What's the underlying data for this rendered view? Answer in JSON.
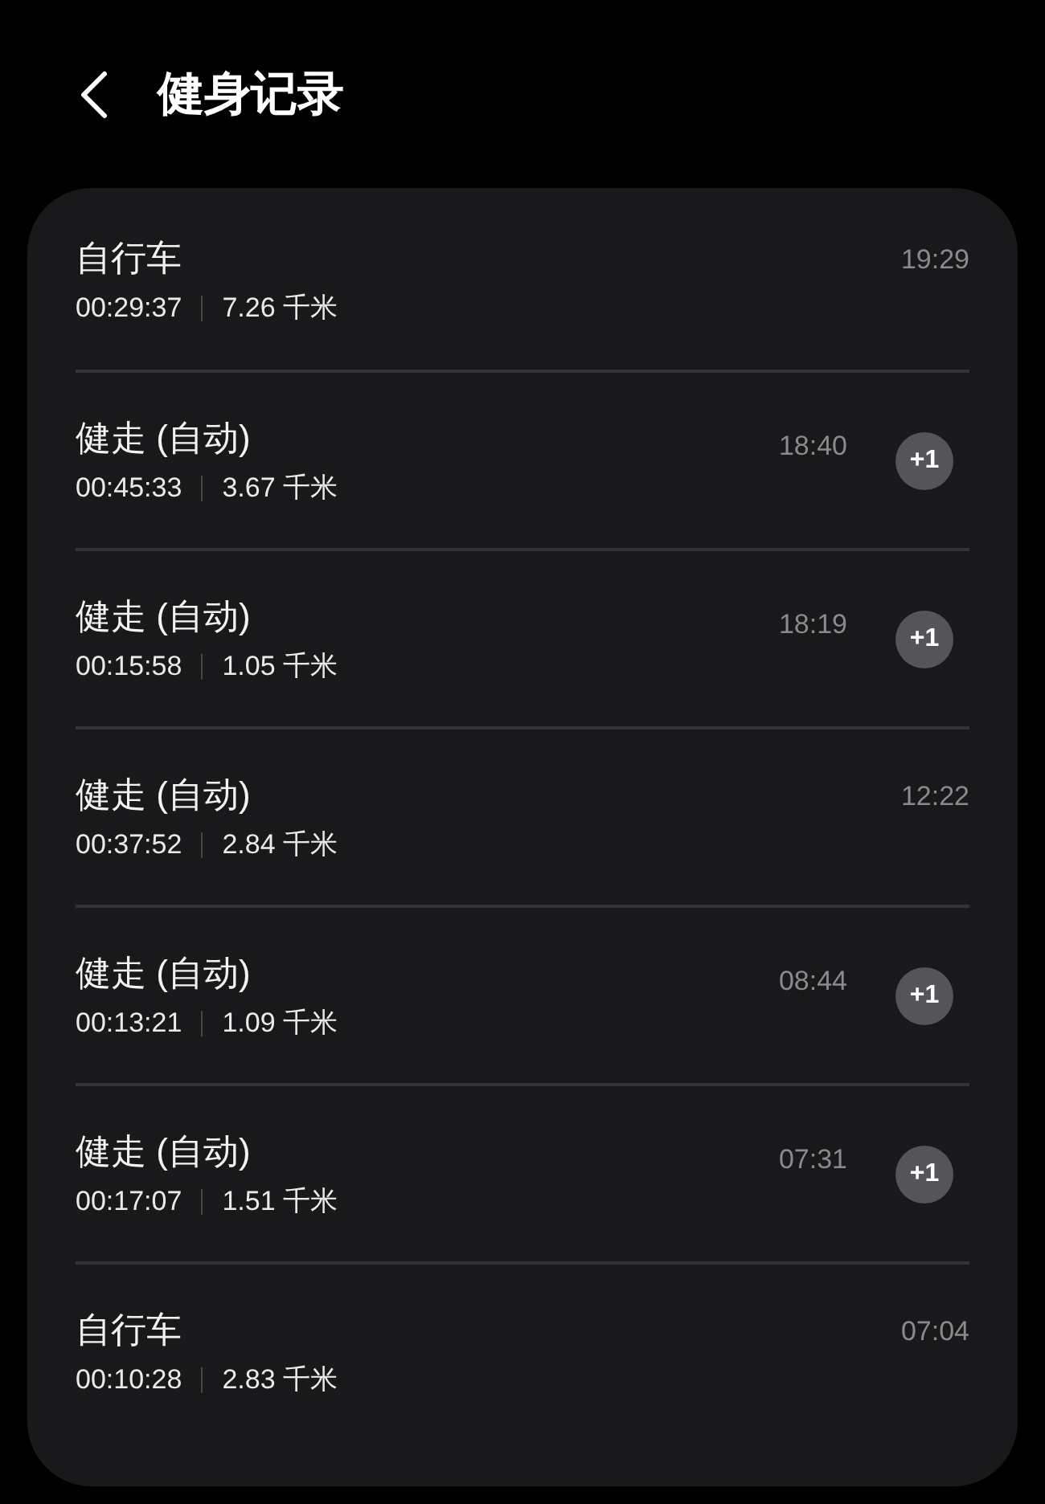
{
  "header": {
    "title": "健身记录"
  },
  "records": [
    {
      "name": "自行车",
      "duration": "00:29:37",
      "distance": "7.26 千米",
      "time": "19:29"
    },
    {
      "name": "健走 (自动)",
      "duration": "00:45:33",
      "distance": "3.67 千米",
      "time": "18:40",
      "badge": "+1"
    },
    {
      "name": "健走 (自动)",
      "duration": "00:15:58",
      "distance": "1.05 千米",
      "time": "18:19",
      "badge": "+1"
    },
    {
      "name": "健走 (自动)",
      "duration": "00:37:52",
      "distance": "2.84 千米",
      "time": "12:22"
    },
    {
      "name": "健走 (自动)",
      "duration": "00:13:21",
      "distance": "1.09 千米",
      "time": "08:44",
      "badge": "+1"
    },
    {
      "name": "健走 (自动)",
      "duration": "00:17:07",
      "distance": "1.51 千米",
      "time": "07:31",
      "badge": "+1"
    },
    {
      "name": "自行车",
      "duration": "00:10:28",
      "distance": "2.83 千米",
      "time": "07:04"
    }
  ]
}
